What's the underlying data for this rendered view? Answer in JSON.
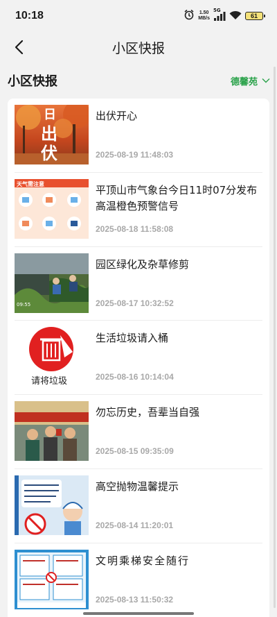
{
  "status": {
    "time": "10:18",
    "speed_value": "1.50",
    "speed_unit": "MB/s",
    "network": "5G",
    "battery": "61",
    "icons": [
      "alarm-icon",
      "signal-icon",
      "wifi-icon",
      "battery-icon"
    ]
  },
  "nav": {
    "title": "小区快报"
  },
  "section": {
    "title": "小区快报",
    "community": "德馨苑"
  },
  "colors": {
    "accent": "#2aa24a",
    "date": "#a8a8a8",
    "card": "#ffffff",
    "page_bg": "#f2f2f2"
  },
  "items": [
    {
      "title": "出伏开心",
      "date": "2025-08-19 11:48:03",
      "thumb_text": "出伏"
    },
    {
      "title": "平顶山市气象台今日11时07分发布高温橙色预警信号",
      "date": "2025-08-18 11:58:08",
      "thumb_text": "天气需注意"
    },
    {
      "title": "园区绿化及杂草修剪",
      "date": "2025-08-17 10:32:52",
      "thumb_text": ""
    },
    {
      "title": "生活垃圾请入桶",
      "date": "2025-08-16 10:14:04",
      "thumb_text": "请将垃圾"
    },
    {
      "title": "勿忘历史，吾辈当自强",
      "date": "2025-08-15 09:35:09",
      "thumb_text": ""
    },
    {
      "title": "高空抛物温馨提示",
      "date": "2025-08-14 11:20:01",
      "thumb_text": ""
    },
    {
      "title": "文明乘梯安全随行",
      "date": "2025-08-13 11:50:32",
      "thumb_text": ""
    }
  ]
}
